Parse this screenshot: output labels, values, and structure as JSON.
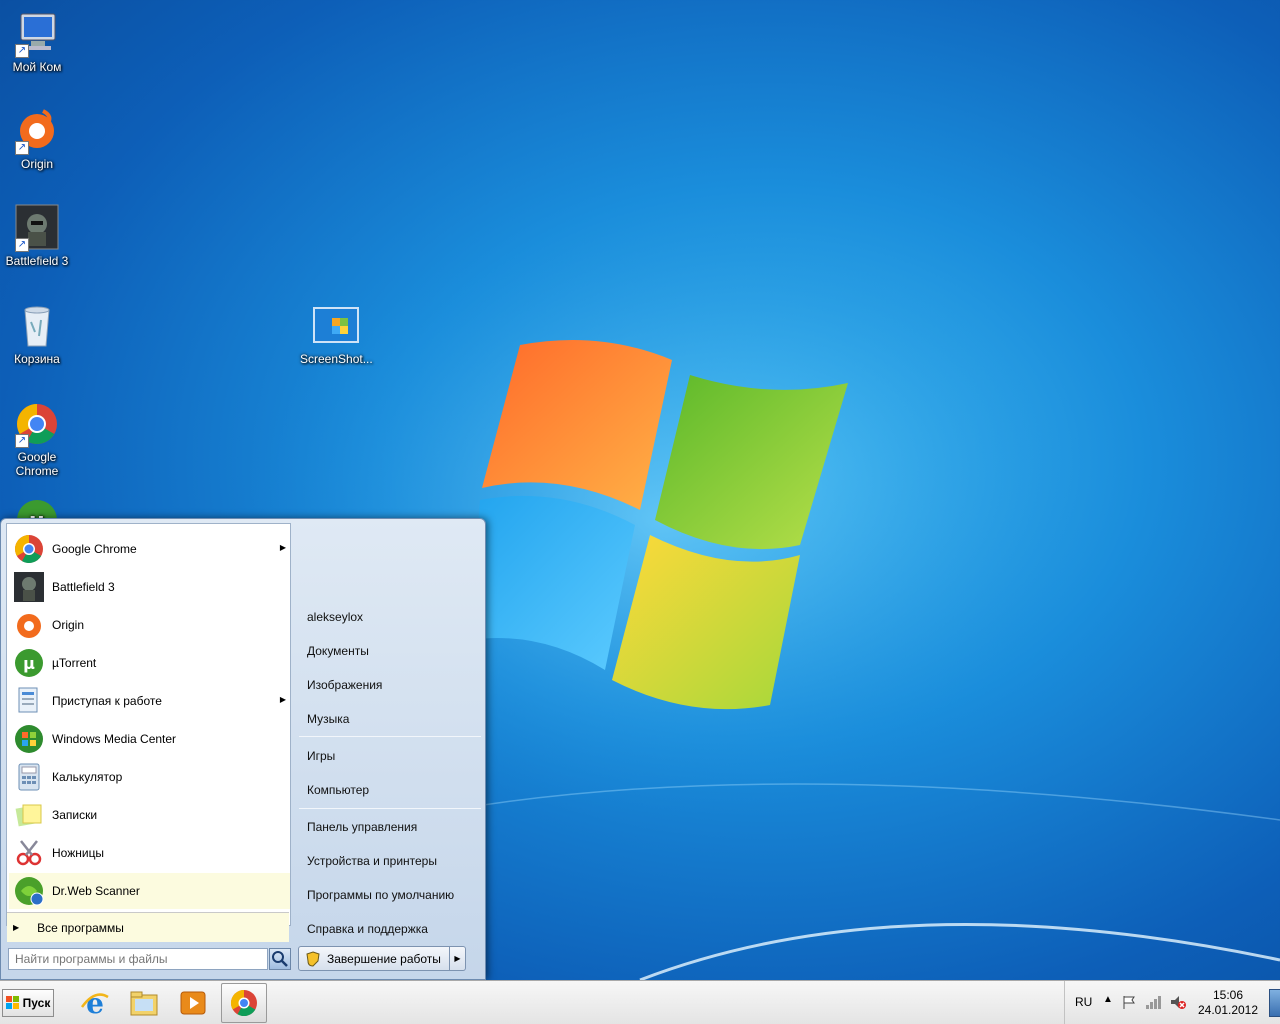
{
  "desktop": {
    "icons": [
      {
        "label": "Мой Ком"
      },
      {
        "label": "Origin"
      },
      {
        "label": "Battlefield 3"
      },
      {
        "label": "Корзина"
      },
      {
        "label": "Google Chrome"
      },
      {
        "label": "ScreenShot..."
      }
    ]
  },
  "start_menu": {
    "programs": [
      {
        "label": "Google Chrome",
        "has_submenu": true
      },
      {
        "label": "Battlefield 3",
        "has_submenu": false
      },
      {
        "label": "Origin",
        "has_submenu": false
      },
      {
        "label": "µTorrent",
        "has_submenu": false
      },
      {
        "label": "Приступая к работе",
        "has_submenu": true
      },
      {
        "label": "Windows Media Center",
        "has_submenu": false
      },
      {
        "label": "Калькулятор",
        "has_submenu": false
      },
      {
        "label": "Записки",
        "has_submenu": false
      },
      {
        "label": "Ножницы",
        "has_submenu": false
      },
      {
        "label": "Dr.Web Scanner",
        "has_submenu": false,
        "highlighted": true
      }
    ],
    "all_programs_label": "Все программы",
    "search_placeholder": "Найти программы и файлы",
    "places": [
      {
        "label": "alekseylox"
      },
      {
        "label": "Документы"
      },
      {
        "label": "Изображения"
      },
      {
        "label": "Музыка"
      },
      {
        "label": "Игры"
      },
      {
        "label": "Компьютер"
      },
      {
        "label": "Панель управления"
      },
      {
        "label": "Устройства и принтеры"
      },
      {
        "label": "Программы по умолчанию"
      },
      {
        "label": "Справка и поддержка"
      }
    ],
    "shutdown_label": "Завершение работы"
  },
  "taskbar": {
    "start_label": "Пуск",
    "pinned": [
      {
        "icon": "internet-explorer-icon"
      },
      {
        "icon": "explorer-folder-icon"
      },
      {
        "icon": "media-player-icon"
      },
      {
        "icon": "chrome-icon"
      }
    ],
    "tray": {
      "language": "RU",
      "time": "15:06",
      "date": "24.01.2012"
    }
  }
}
